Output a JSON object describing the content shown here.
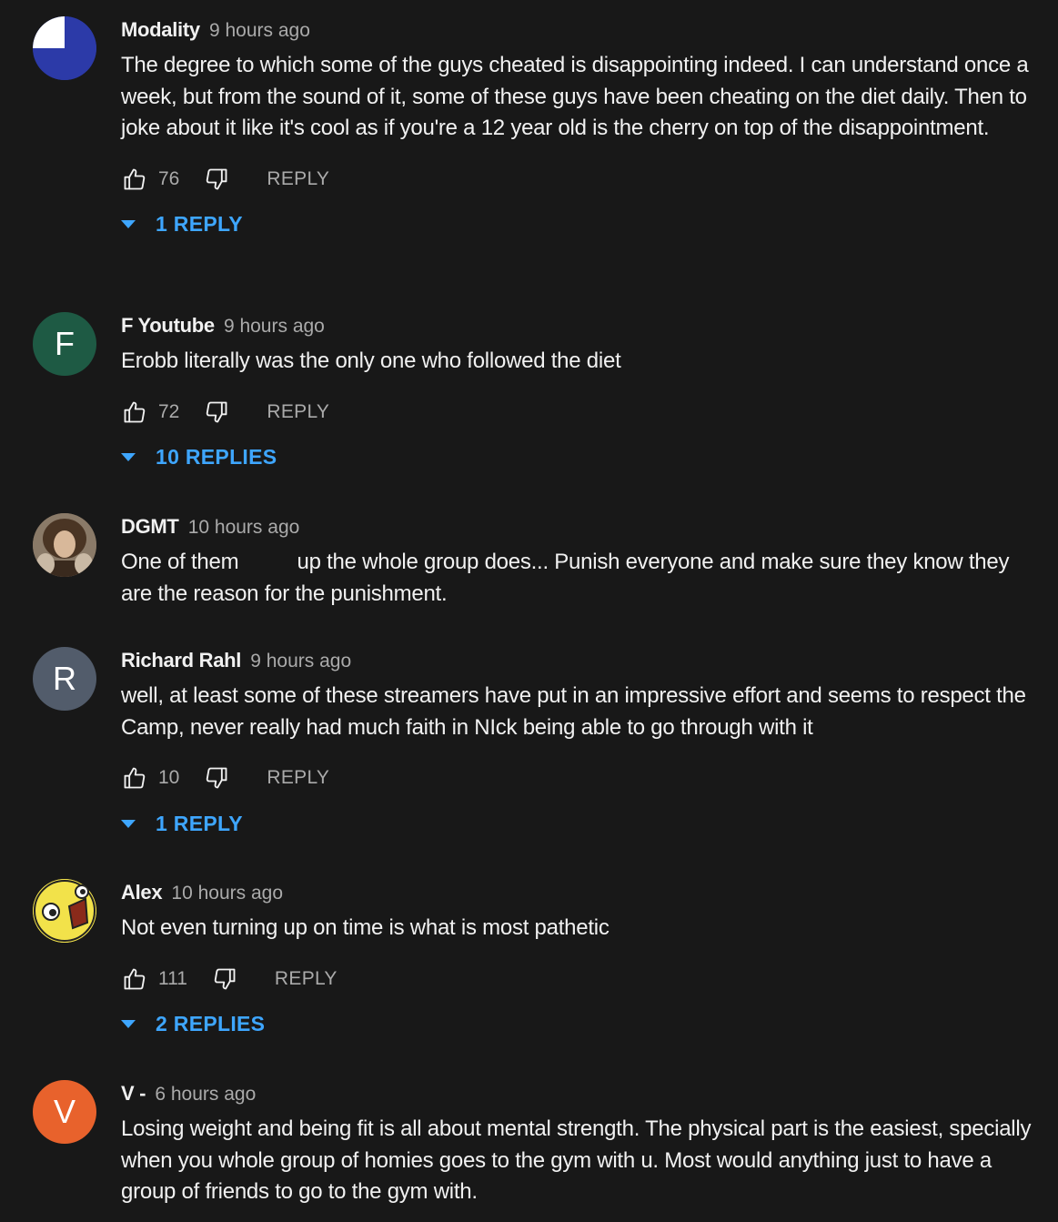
{
  "comments": [
    {
      "author": "Modality",
      "time": "9 hours ago",
      "text": "The degree to which some of the guys cheated is disappointing indeed. I can understand once a week, but from the sound of it, some of these guys have been cheating on the diet daily. Then to joke about it like it's cool as if you're a 12 year old is the cherry on top of the disappointment.",
      "likes": "76",
      "reply_label": "REPLY",
      "replies_label": "1 REPLY",
      "avatar_color": "#2c3aa8"
    },
    {
      "author": "F Youtube",
      "time": "9 hours ago",
      "text": "Erobb literally was the only one who followed the diet",
      "likes": "72",
      "reply_label": "REPLY",
      "replies_label": "10 REPLIES",
      "avatar_letter": "F",
      "avatar_color": "#1e5a44"
    },
    {
      "author": "DGMT",
      "time": "10 hours ago",
      "text": "One of them          up the whole group does... Punish everyone and make sure they know they are the reason for the punishment."
    },
    {
      "author": "Richard Rahl",
      "time": "9 hours ago",
      "text": "well, at least some of these streamers have put in an impressive effort and seems to respect the Camp, never really had much faith in NIck being able to go through with it",
      "likes": "10",
      "reply_label": "REPLY",
      "replies_label": "1 REPLY",
      "avatar_letter": "R",
      "avatar_color": "#525c6b"
    },
    {
      "author": "Alex",
      "time": "10 hours ago",
      "text": "Not even turning up on time is what is most pathetic",
      "likes": "111",
      "reply_label": "REPLY",
      "replies_label": "2 REPLIES",
      "avatar_color": "#f2e24a"
    },
    {
      "author": "V -",
      "time": "6 hours ago",
      "text": "Losing weight and being fit is all about mental strength. The physical part is the easiest, specially when you whole group of homies goes to the gym with u. Most would anything just to have a group of friends to go to the gym with.",
      "avatar_letter": "V",
      "avatar_color": "#e8622c"
    }
  ],
  "colors": {
    "background": "#181818",
    "link_blue": "#3ea6ff",
    "secondary_text": "#aaaaaa"
  },
  "icons": {
    "like": "thumbs-up-icon",
    "dislike": "thumbs-down-icon",
    "expand": "caret-down-icon"
  }
}
